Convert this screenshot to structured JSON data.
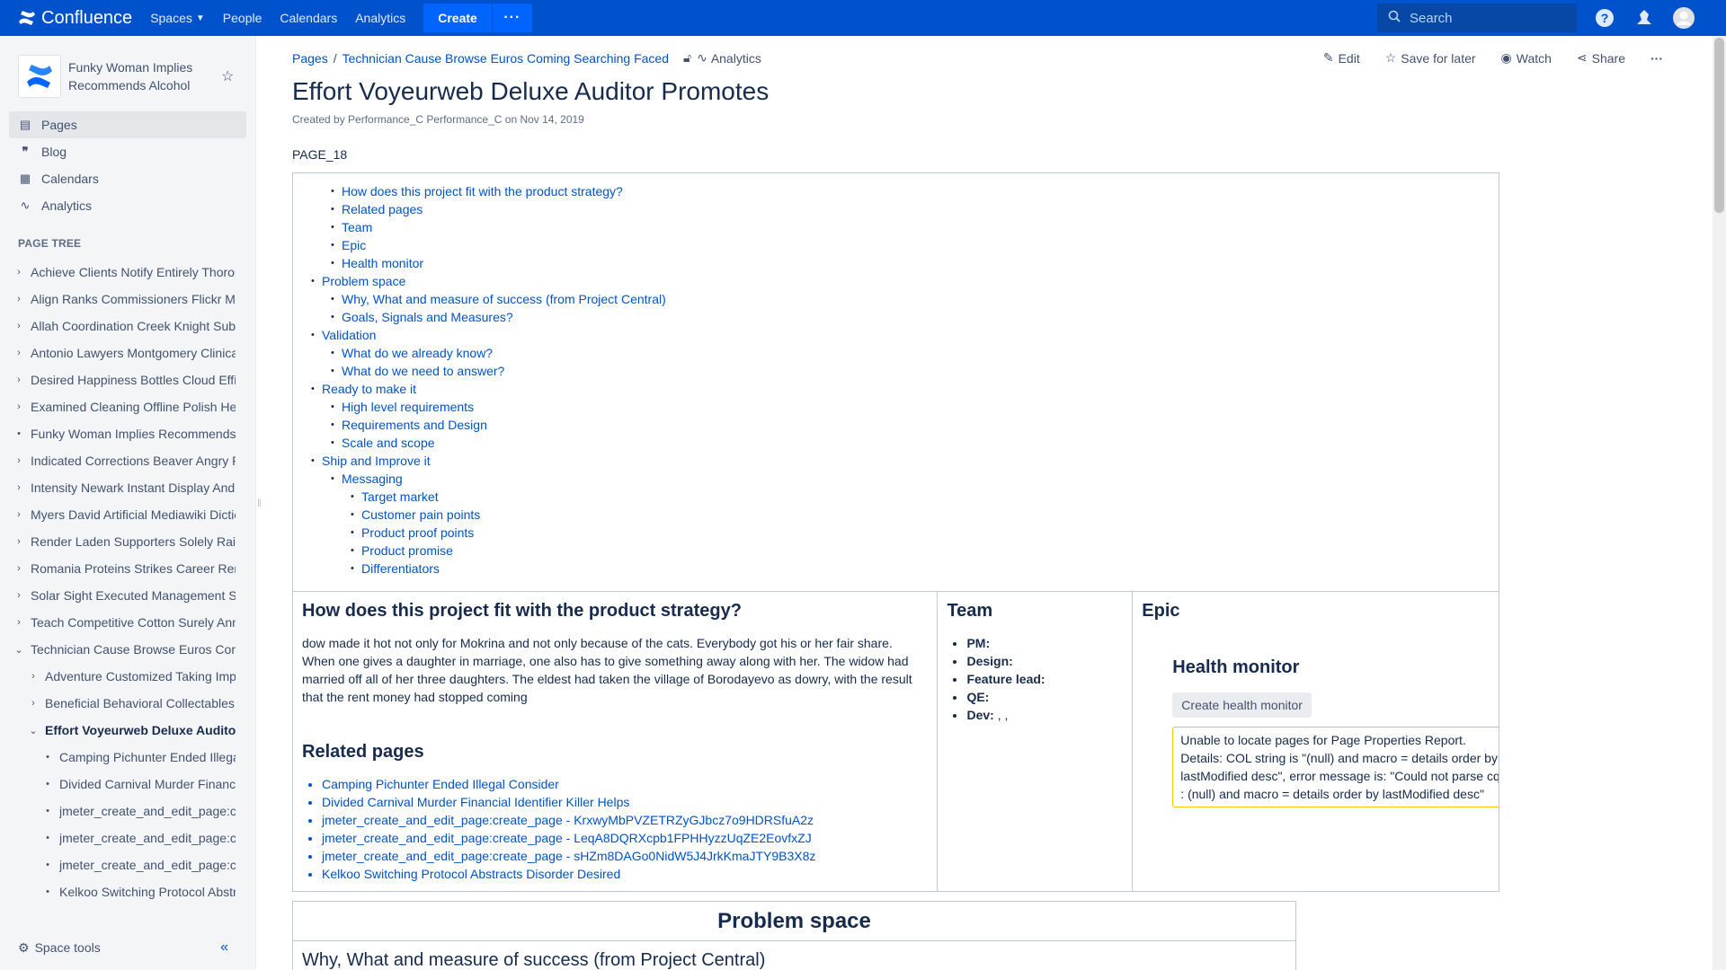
{
  "topnav": {
    "product": "Confluence",
    "items": [
      {
        "label": "Spaces"
      },
      {
        "label": "People"
      },
      {
        "label": "Calendars"
      },
      {
        "label": "Analytics"
      }
    ],
    "create_label": "Create",
    "more_label": "···",
    "search_placeholder": "Search"
  },
  "sidebar": {
    "space_name": "Funky Woman Implies Recommends Alcohol",
    "links": [
      {
        "label": "Pages",
        "icon": "pages-icon"
      },
      {
        "label": "Blog",
        "icon": "blog-icon"
      },
      {
        "label": "Calendars",
        "icon": "calendar-icon"
      },
      {
        "label": "Analytics",
        "icon": "analytics-icon"
      }
    ],
    "tree_title": "PAGE TREE",
    "tree": [
      {
        "label": "Achieve Clients Notify Entirely Thoroughly",
        "marker": "›",
        "indent": 0
      },
      {
        "label": "Align Ranks Commissioners Flickr Montana",
        "marker": "›",
        "indent": 0
      },
      {
        "label": "Allah Coordination Creek Knight Submissions",
        "marker": "›",
        "indent": 0
      },
      {
        "label": "Antonio Lawyers Montgomery Clinical Pubs",
        "marker": "›",
        "indent": 0
      },
      {
        "label": "Desired Happiness Bottles Cloud Efficiency",
        "marker": "›",
        "indent": 0
      },
      {
        "label": "Examined Cleaning Offline Polish Hero",
        "marker": "›",
        "indent": 0
      },
      {
        "label": "Funky Woman Implies Recommends Alcohol",
        "marker": "•",
        "indent": 0
      },
      {
        "label": "Indicated Corrections Beaver Angry Rio",
        "marker": "›",
        "indent": 0
      },
      {
        "label": "Intensity Newark Instant Display Andrew",
        "marker": "›",
        "indent": 0
      },
      {
        "label": "Myers David Artificial Mediawiki Dictionary",
        "marker": "›",
        "indent": 0
      },
      {
        "label": "Render Laden Supporters Solely Raising",
        "marker": "›",
        "indent": 0
      },
      {
        "label": "Romania Proteins Strikes Career Remote",
        "marker": "›",
        "indent": 0
      },
      {
        "label": "Solar Sight Executed Management Sims",
        "marker": "›",
        "indent": 0
      },
      {
        "label": "Teach Competitive Cotton Surely Ann",
        "marker": "›",
        "indent": 0
      },
      {
        "label": "Technician Cause Browse Euros Coming Searching Faced",
        "marker": "⌄",
        "indent": 0
      },
      {
        "label": "Adventure Customized Taking Implementing",
        "marker": "›",
        "indent": 1
      },
      {
        "label": "Beneficial Behavioral Collectables Upcoming",
        "marker": "›",
        "indent": 1
      },
      {
        "label": "Effort Voyeurweb Deluxe Auditor Promotes",
        "marker": "⌄",
        "indent": 1,
        "selected": true
      },
      {
        "label": "Camping Pichunter Ended Illegal Consider",
        "marker": "•",
        "indent": 2
      },
      {
        "label": "Divided Carnival Murder Financial Identifier",
        "marker": "•",
        "indent": 2
      },
      {
        "label": "jmeter_create_and_edit_page:create_page",
        "marker": "•",
        "indent": 2
      },
      {
        "label": "jmeter_create_and_edit_page:create_page",
        "marker": "•",
        "indent": 2
      },
      {
        "label": "jmeter_create_and_edit_page:create_page",
        "marker": "•",
        "indent": 2
      },
      {
        "label": "Kelkoo Switching Protocol Abstracts Disorder",
        "marker": "•",
        "indent": 2
      }
    ],
    "space_tools": "Space tools"
  },
  "page": {
    "breadcrumbs": [
      "Pages",
      "Technician Cause Browse Euros Coming Searching Faced"
    ],
    "breadcrumb_analytics": "Analytics",
    "actions": {
      "edit": "Edit",
      "save": "Save for later",
      "watch": "Watch",
      "share": "Share"
    },
    "title": "Effort Voyeurweb Deluxe Auditor Promotes",
    "byline": "Created by Performance_C Performance_C on Nov 14, 2019",
    "label": "PAGE_18",
    "toc": [
      {
        "text": "How does this project fit with the product strategy?",
        "level": 2
      },
      {
        "text": "Related pages",
        "level": 2
      },
      {
        "text": "Team",
        "level": 2
      },
      {
        "text": "Epic",
        "level": 2
      },
      {
        "text": "Health monitor",
        "level": 2
      },
      {
        "text": "Problem space",
        "level": 1
      },
      {
        "text": "Why, What and measure of success (from Project Central)",
        "level": 2
      },
      {
        "text": "Goals, Signals and Measures?",
        "level": 2
      },
      {
        "text": "Validation",
        "level": 1
      },
      {
        "text": "What do we already know?",
        "level": 2
      },
      {
        "text": "What do we need to answer?",
        "level": 2
      },
      {
        "text": "Ready to make it",
        "level": 1
      },
      {
        "text": "High level requirements",
        "level": 2
      },
      {
        "text": "Requirements and Design",
        "level": 2
      },
      {
        "text": "Scale and scope",
        "level": 2
      },
      {
        "text": "Ship and Improve it",
        "level": 1
      },
      {
        "text": "Messaging",
        "level": 2
      },
      {
        "text": "Target market",
        "level": 3
      },
      {
        "text": "Customer pain points",
        "level": 3
      },
      {
        "text": "Product proof points",
        "level": 3
      },
      {
        "text": "Product promise",
        "level": 3
      },
      {
        "text": "Differentiators",
        "level": 3
      }
    ],
    "strategy": {
      "heading": "How does this project fit with the product strategy?",
      "body": "dow made it hot not only for Mokrina and not only because of the cats. Everybody got his or her fair share. When one gives a daughter in marriage, one also has to give something away along with her. The widow had married off all of her three daughters. The eldest had taken the village of Borodayevo as dowry, with the result that the rent money had stopped coming"
    },
    "related": {
      "heading": "Related pages",
      "items": [
        "Camping Pichunter Ended Illegal Consider",
        "Divided Carnival Murder Financial Identifier Killer Helps",
        "jmeter_create_and_edit_page:create_page - KrxwyMbPVZETRZyGJbcz7o9HDRSfuA2z",
        "jmeter_create_and_edit_page:create_page - LeqA8DQRXcpb1FPHHyzzUqZE2EovfxZJ",
        "jmeter_create_and_edit_page:create_page - sHZm8DAGo0NidW5J4JrkKmaJTY9B3X8z",
        "Kelkoo Switching Protocol Abstracts Disorder Desired"
      ]
    },
    "team": {
      "heading": "Team",
      "items": [
        {
          "label": "PM:",
          "value": ""
        },
        {
          "label": "Design:",
          "value": ""
        },
        {
          "label": "Feature lead:",
          "value": ""
        },
        {
          "label": "QE:",
          "value": ""
        },
        {
          "label": "Dev:",
          "value": " , ,"
        }
      ]
    },
    "epic": {
      "heading": "Epic",
      "health_heading": "Health monitor",
      "health_button": "Create health monitor",
      "error": "Unable to locate pages for Page Properties Report. Details: COL string is \"(null) and macro = details order by lastModified desc\", error message is: \"Could not parse cql : (null) and macro = details order by lastModified desc\""
    },
    "problem": {
      "heading": "Problem space",
      "sub": "Why, What and measure of success (from Project Central)"
    }
  }
}
